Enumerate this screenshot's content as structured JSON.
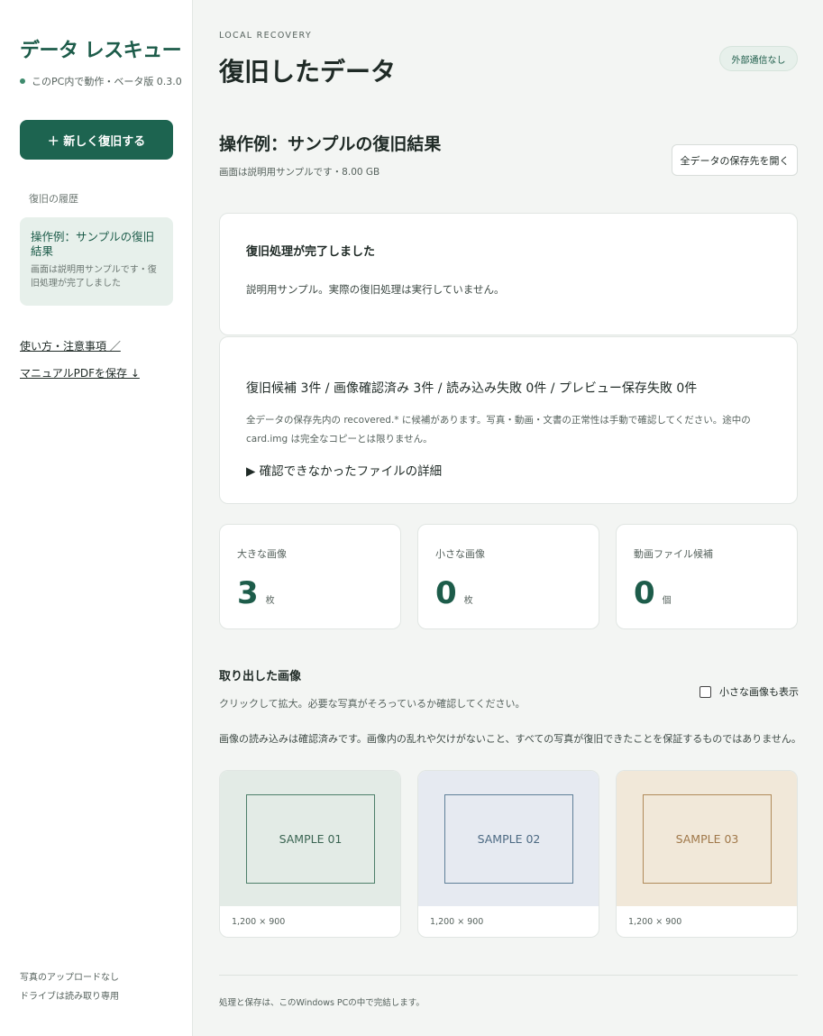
{
  "sidebar": {
    "brand": "データ レスキュー",
    "brand_sub": "このPC内で動作・ベータ版 0.3.0",
    "new_button": "＋ 新しく復旧する",
    "history_label": "復旧の履歴",
    "history_item": {
      "title": "操作例：サンプルの復旧結果",
      "desc": "画面は説明用サンプルです・復旧処理が完了しました"
    },
    "links": [
      "使い方・注意事項 ／",
      "マニュアルPDFを保存 ↓"
    ],
    "footer": [
      "写真のアップロードなし",
      "ドライブは読み取り専用"
    ]
  },
  "header": {
    "eyebrow": "LOCAL RECOVERY",
    "title": "復旧したデータ",
    "badge": "外部通信なし"
  },
  "result": {
    "title": "操作例：サンプルの復旧結果",
    "subtitle": "画面は説明用サンプルです・8.00 GB",
    "open_button": "全データの保存先を開く"
  },
  "status_card": {
    "title": "復旧処理が完了しました",
    "desc": "説明用サンプル。実際の復旧処理は実行していません。"
  },
  "summary_card": {
    "title": "復旧候補 3件 / 画像確認済み 3件 / 読み込み失敗 0件 / プレビュー保存失敗 0件",
    "desc": "全データの保存先内の recovered.* に候補があります。写真・動画・文書の正常性は手動で確認してください。途中の card.img は完全なコピーとは限りません。",
    "details": "▶ 確認できなかったファイルの詳細"
  },
  "stats": [
    {
      "label": "大きな画像",
      "value": "3",
      "unit": "枚"
    },
    {
      "label": "小さな画像",
      "value": "0",
      "unit": "枚"
    },
    {
      "label": "動画ファイル候補",
      "value": "0",
      "unit": "個"
    }
  ],
  "images": {
    "title": "取り出した画像",
    "subtitle": "クリックして拡大。必要な写真がそろっているか確認してください。",
    "toggle_label": "小さな画像も表示",
    "note": "画像の読み込みは確認済みです。画像内の乱れや欠けがないこと、すべての写真が復旧できたことを保証するものではありません。",
    "items": [
      {
        "label": "SAMPLE 01",
        "size": "1,200 × 900",
        "bg": "#e3ebe6",
        "frame": "#4d7f6a",
        "text": "#3b6553"
      },
      {
        "label": "SAMPLE 02",
        "size": "1,200 × 900",
        "bg": "#e6eaf1",
        "frame": "#5f7f98",
        "text": "#4d6a83"
      },
      {
        "label": "SAMPLE 03",
        "size": "1,200 × 900",
        "bg": "#f1e8d9",
        "frame": "#b08a5a",
        "text": "#a0784a"
      }
    ]
  },
  "footer": {
    "note": "処理と保存は、このWindows PCの中で完結します。"
  }
}
